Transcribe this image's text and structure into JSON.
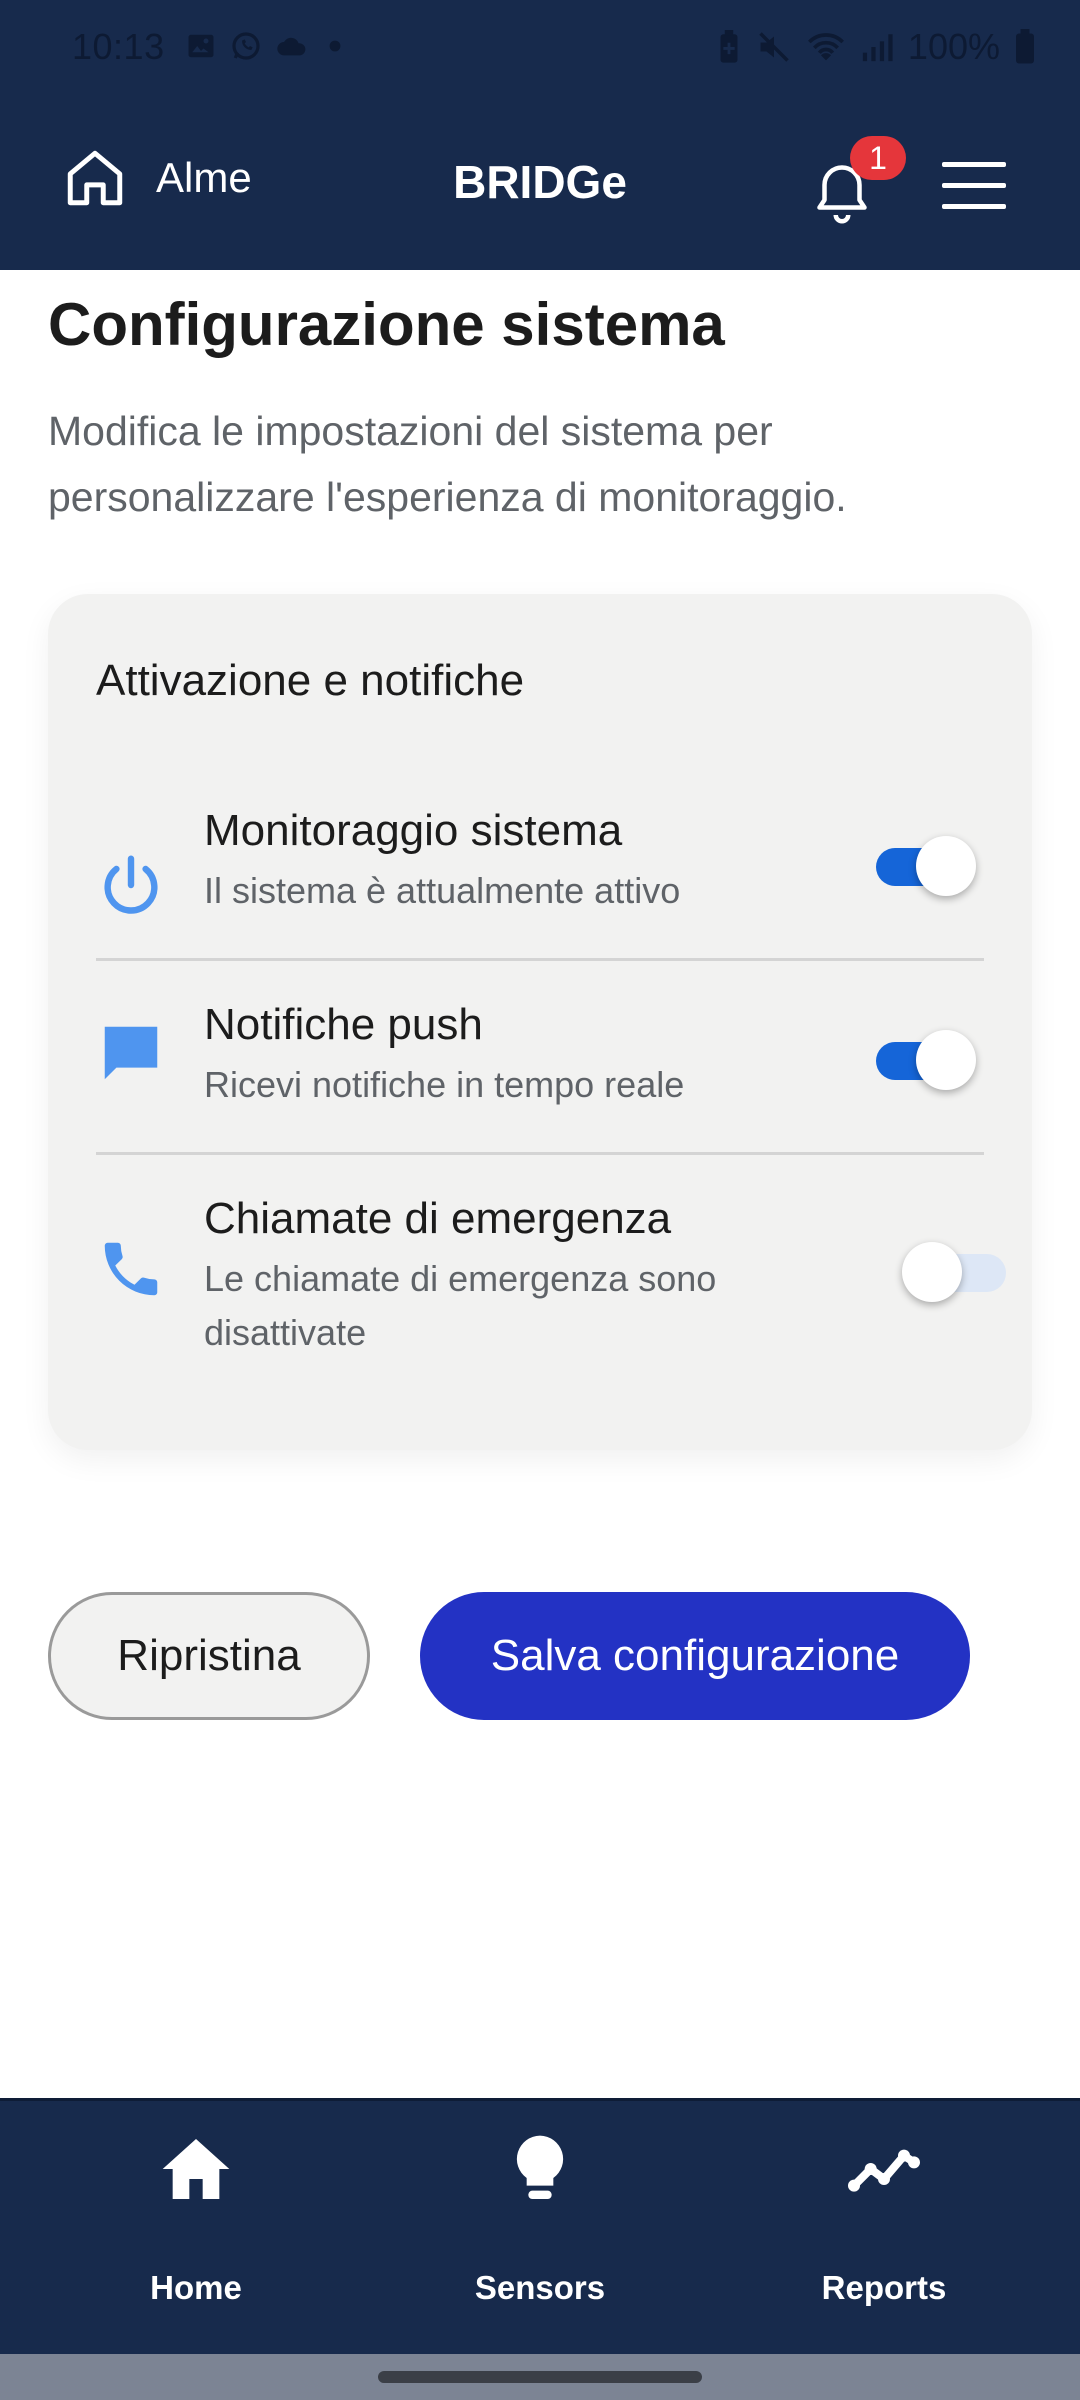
{
  "status_bar": {
    "time": "10:13",
    "battery": "100%"
  },
  "header": {
    "home_label": "Alme",
    "app_title": "BRIDGe",
    "notification_count": "1"
  },
  "page": {
    "title": "Configurazione sistema",
    "subtitle": "Modifica le impostazioni del sistema per personalizzare l'esperienza di monitoraggio."
  },
  "card": {
    "title": "Attivazione e notifiche",
    "settings": [
      {
        "icon": "power-icon",
        "name": "Monitoraggio sistema",
        "description": "Il sistema è attualmente attivo",
        "enabled": true
      },
      {
        "icon": "chat-bubble-icon",
        "name": "Notifiche push",
        "description": "Ricevi notifiche in tempo reale",
        "enabled": true
      },
      {
        "icon": "phone-icon",
        "name": "Chiamate di emergenza",
        "description": "Le chiamate di emergenza sono disattivate",
        "enabled": false
      }
    ]
  },
  "actions": {
    "reset_label": "Ripristina",
    "save_label": "Salva configurazione"
  },
  "bottom_nav": {
    "items": [
      {
        "icon": "home-icon",
        "label": "Home"
      },
      {
        "icon": "lightbulb-icon",
        "label": "Sensors"
      },
      {
        "icon": "trend-line-icon",
        "label": "Reports"
      }
    ]
  },
  "colors": {
    "header_bg": "#172a4c",
    "primary_button": "#2332c4",
    "toggle_on": "#1565d8",
    "icon_blue": "#4f95ef",
    "badge": "#e5363b"
  }
}
